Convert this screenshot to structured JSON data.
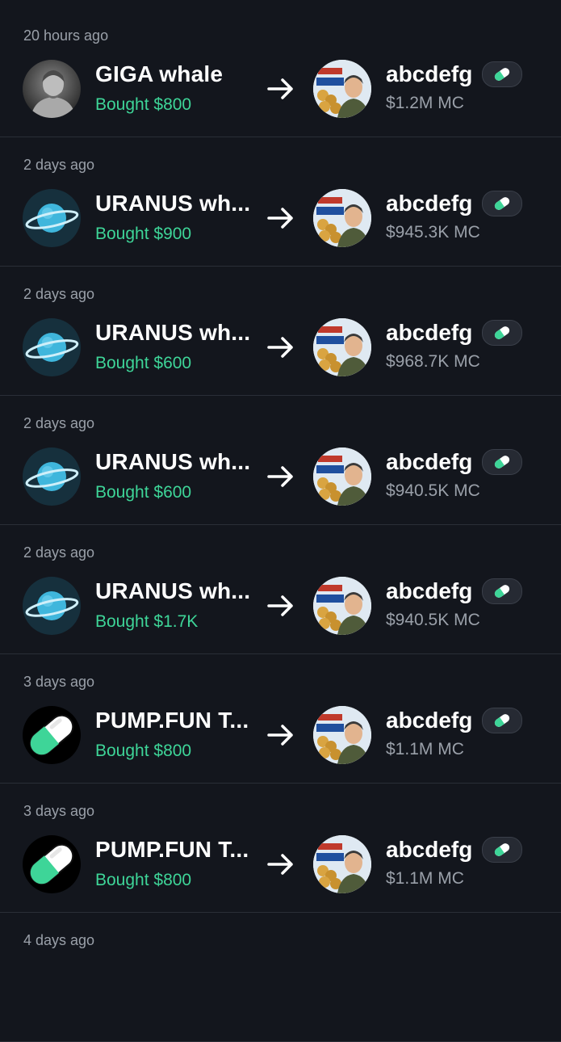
{
  "colors": {
    "background": "#13161d",
    "divider": "#2a2e37",
    "bought_green": "#3ed598",
    "muted_text": "#9aa0a9",
    "pill_green": "#3ed598"
  },
  "feed": [
    {
      "time": "20 hours ago",
      "user": "GIGA whale",
      "user_avatar": "giga-chad-avatar",
      "action": "Bought $800",
      "token": "abcdefg",
      "market_cap": "$1.2M MC"
    },
    {
      "time": "2 days ago",
      "user": "URANUS wh...",
      "user_avatar": "planet-icon",
      "action": "Bought $900",
      "token": "abcdefg",
      "market_cap": "$945.3K MC"
    },
    {
      "time": "2 days ago",
      "user": "URANUS wh...",
      "user_avatar": "planet-icon",
      "action": "Bought $600",
      "token": "abcdefg",
      "market_cap": "$968.7K MC"
    },
    {
      "time": "2 days ago",
      "user": "URANUS wh...",
      "user_avatar": "planet-icon",
      "action": "Bought $600",
      "token": "abcdefg",
      "market_cap": "$940.5K MC"
    },
    {
      "time": "2 days ago",
      "user": "URANUS wh...",
      "user_avatar": "planet-icon",
      "action": "Bought $1.7K",
      "token": "abcdefg",
      "market_cap": "$940.5K MC"
    },
    {
      "time": "3 days ago",
      "user": "PUMP.FUN T...",
      "user_avatar": "pill-icon",
      "action": "Bought $800",
      "token": "abcdefg",
      "market_cap": "$1.1M MC"
    },
    {
      "time": "3 days ago",
      "user": "PUMP.FUN T...",
      "user_avatar": "pill-icon",
      "action": "Bought $800",
      "token": "abcdefg",
      "market_cap": "$1.1M MC"
    }
  ],
  "partial_item": {
    "time": "4 days ago"
  }
}
